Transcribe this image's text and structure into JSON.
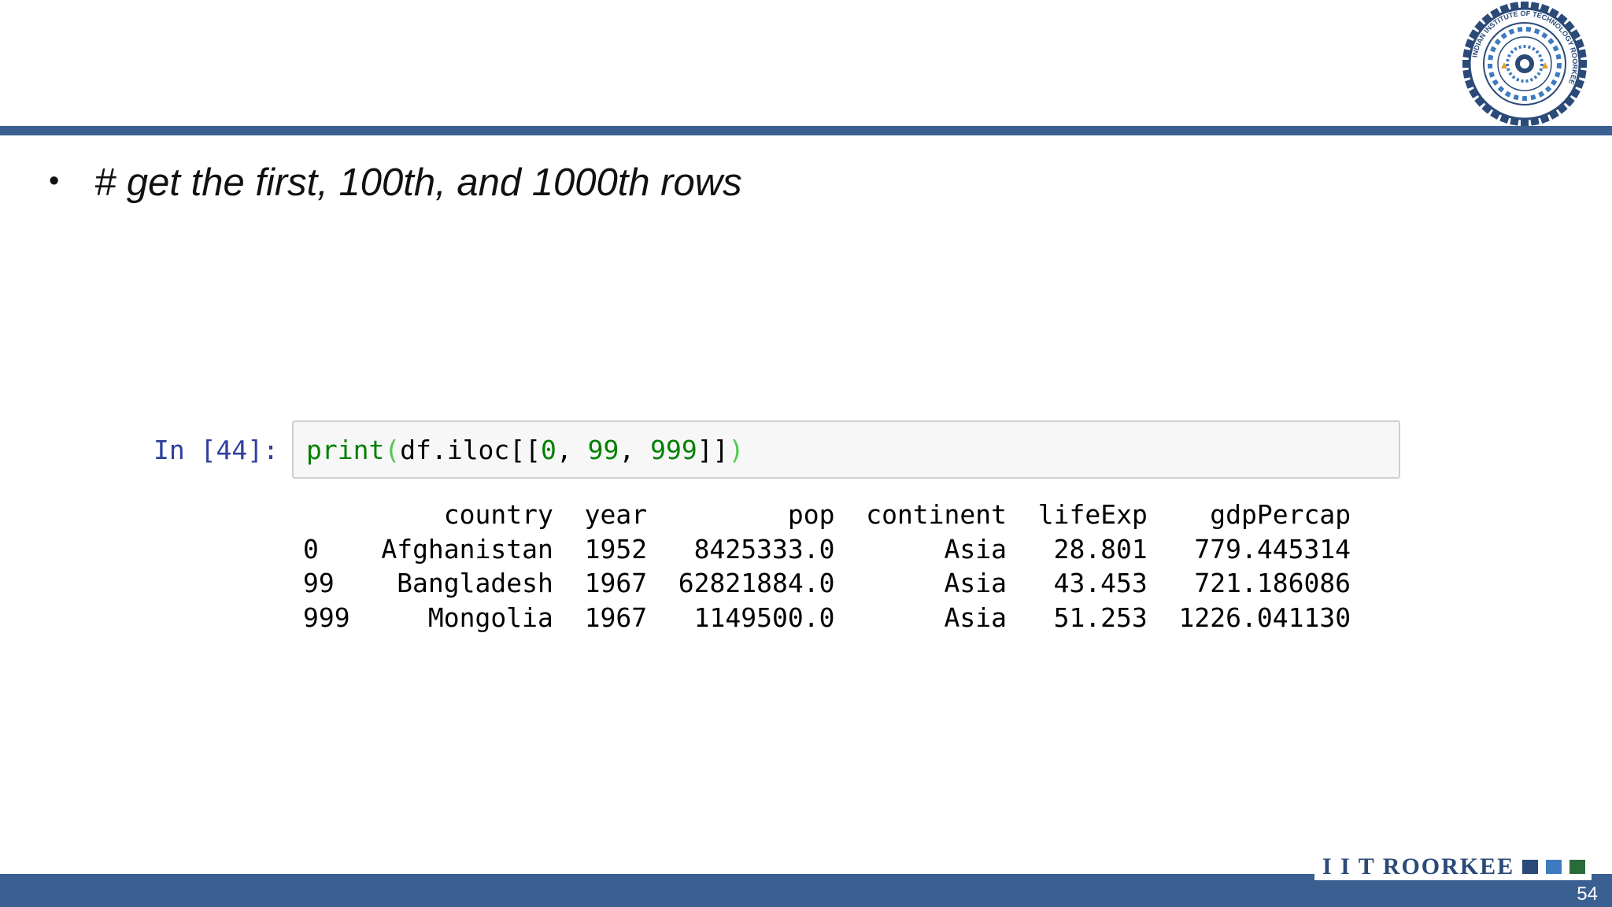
{
  "slide": {
    "bullet_text": "# get the first, 100th, and 1000th rows",
    "bullet_symbol": "•",
    "page_number": "54",
    "footer_brand": "I I T ROORKEE",
    "accent_color": "#3a5f91"
  },
  "logo": {
    "icon": "iit-roorkee-seal-icon",
    "text": "INDIAN INSTITUTE OF TECHNOLOGY ROORKEE"
  },
  "notebook": {
    "prompt": "In [44]:",
    "code_tokens": [
      {
        "text": "print",
        "cls": "tk-builtin"
      },
      {
        "text": "(",
        "cls": "tk-paren"
      },
      {
        "text": "df.iloc[[",
        "cls": "tk-plain"
      },
      {
        "text": "0",
        "cls": "tk-num"
      },
      {
        "text": ", ",
        "cls": "tk-plain"
      },
      {
        "text": "99",
        "cls": "tk-num"
      },
      {
        "text": ", ",
        "cls": "tk-plain"
      },
      {
        "text": "999",
        "cls": "tk-num"
      },
      {
        "text": "]]",
        "cls": "tk-plain"
      },
      {
        "text": ")",
        "cls": "tk-paren"
      }
    ],
    "output": {
      "columns": [
        "country",
        "year",
        "pop",
        "continent",
        "lifeExp",
        "gdpPercap"
      ],
      "rows": [
        {
          "index": "0",
          "values": [
            "Afghanistan",
            "1952",
            "8425333.0",
            "Asia",
            "28.801",
            "779.445314"
          ]
        },
        {
          "index": "99",
          "values": [
            "Bangladesh",
            "1967",
            "62821884.0",
            "Asia",
            "43.453",
            "721.186086"
          ]
        },
        {
          "index": "999",
          "values": [
            "Mongolia",
            "1967",
            "1149500.0",
            "Asia",
            "51.253",
            "1226.041130"
          ]
        }
      ]
    }
  }
}
